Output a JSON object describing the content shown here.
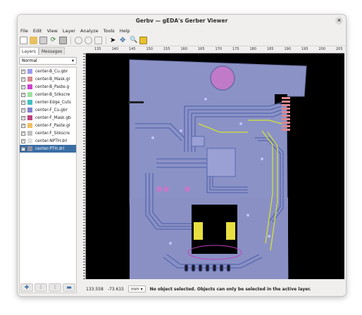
{
  "window": {
    "title": "Gerbv — gEDA's Gerber Viewer",
    "close_glyph": "×"
  },
  "menu": [
    "File",
    "Edit",
    "View",
    "Layer",
    "Analyze",
    "Tools",
    "Help"
  ],
  "tabs": {
    "layers": "Layers",
    "messages": "Messages"
  },
  "render_mode": "Normal",
  "layers": [
    {
      "name": "center-B_Cu.gbr",
      "color": "#9c9cf0",
      "checked": true
    },
    {
      "name": "center-B_Mask.gl",
      "color": "#d88890",
      "checked": true
    },
    {
      "name": "center-B_Paste.g",
      "color": "#d040d0",
      "checked": true
    },
    {
      "name": "center-B_Silkscre",
      "color": "#a0e0a0",
      "checked": true
    },
    {
      "name": "center-Edge_Cuts",
      "color": "#40c0c0",
      "checked": true
    },
    {
      "name": "center-F_Cu.gbr",
      "color": "#8080d0",
      "checked": true
    },
    {
      "name": "center-F_Mask.gb",
      "color": "#c04080",
      "checked": true
    },
    {
      "name": "center-F_Paste.gl",
      "color": "#f0c060",
      "checked": true
    },
    {
      "name": "center-F_Silkscre",
      "color": "#c0c0c0",
      "checked": true
    },
    {
      "name": "center-NPTH.drl",
      "color": "#e0e0e0",
      "checked": true
    },
    {
      "name": "center-PTH.drl",
      "color": "#9090a0",
      "checked": true,
      "selected": true
    }
  ],
  "ruler_ticks": [
    "135",
    "140",
    "145",
    "150",
    "155",
    "160",
    "165",
    "170",
    "175",
    "180",
    "185",
    "190",
    "195",
    "200",
    "205"
  ],
  "status": {
    "x": "133.558",
    "y": "-73.615",
    "unit": "mm",
    "message": "No object selected. Objects can only be selected in the active layer."
  },
  "colors": {
    "canvas_bg": "#000000",
    "board": "#8c93c8",
    "copper_trace": "#5a6bb0",
    "paste": "#e8e040",
    "selection": "#3b6ea5"
  }
}
